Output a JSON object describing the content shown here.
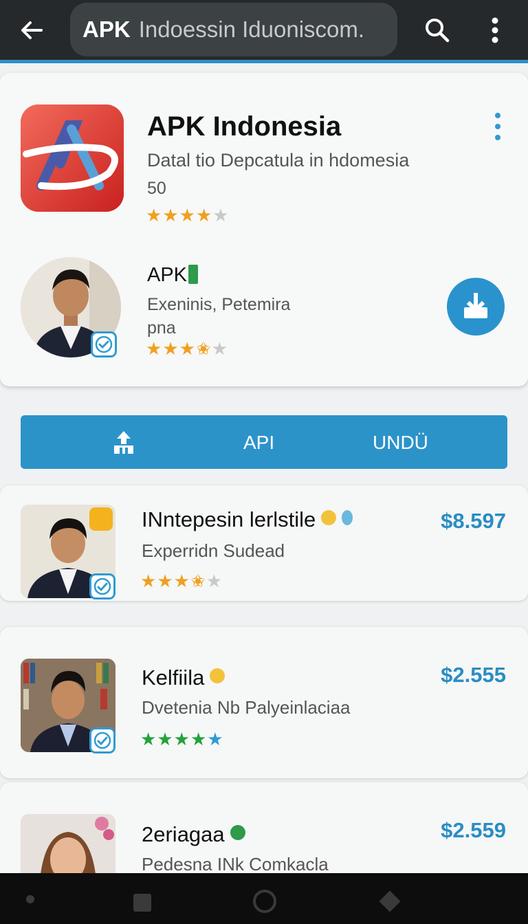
{
  "top_bar": {
    "search": {
      "strong": "APK",
      "rest": "Indoessin Iduoniscom."
    },
    "icons": {
      "back": "arrow-left-icon",
      "search": "search-icon",
      "more": "more-vert-icon"
    }
  },
  "featured": {
    "title": "APK Indonesia",
    "subtitle": "Datal tio Depcatula in hdomesia",
    "count": "50",
    "rating": 3.5,
    "developer": {
      "name": "APK",
      "desc_line1": "Exeninis, Petemira",
      "desc_line2": "pna",
      "rating": 3.5
    }
  },
  "action_bar": {
    "label_1": "API",
    "label_2": "UNDÜ"
  },
  "items": [
    {
      "title": "INntepesin lerlstile",
      "subtitle": "Experridn Sudead",
      "price": "$8.597",
      "rating": 3.5
    },
    {
      "title": "Kelfiila",
      "subtitle": "Dvetenia Nb Palyeinlaciaa",
      "price": "$2.555",
      "rating": 5
    },
    {
      "title": "2eriagaa",
      "subtitle": "Pedesna INk Comkacla",
      "price": "$2.559"
    }
  ],
  "colors": {
    "accent": "#2c93c9",
    "star": "#f0a020",
    "star_green": "#22a23a"
  }
}
